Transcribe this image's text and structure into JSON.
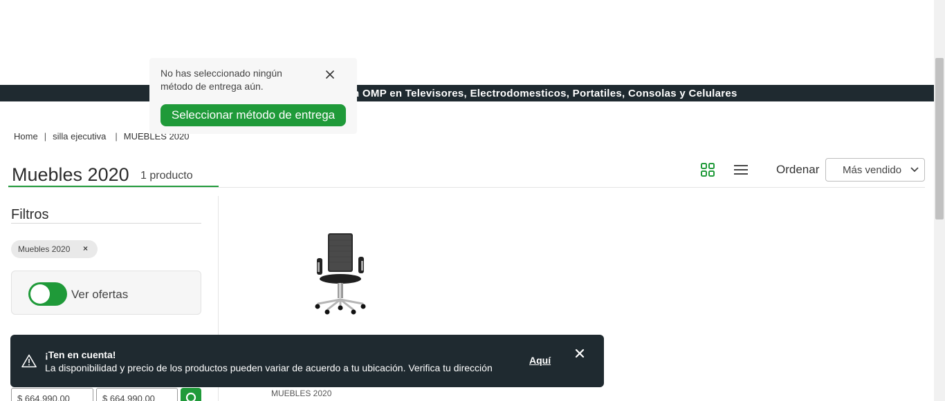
{
  "announcement": {
    "text": "n OMP en Televisores, Electrodomesticos, Portatiles, Consolas y Celulares"
  },
  "delivery_popover": {
    "message": "No has seleccionado ningún método de entrega aún.",
    "cta_label": "Seleccionar método de entrega",
    "close_icon": "close-icon"
  },
  "breadcrumb": [
    "Home",
    "silla ejecutiva",
    "MUEBLES 2020"
  ],
  "header": {
    "title": "Muebles 2020",
    "count": "1 producto"
  },
  "view_toggle": {
    "grid_icon": "grid-view-icon",
    "list_icon": "list-view-icon",
    "active": "grid"
  },
  "sort": {
    "label": "Ordenar",
    "value": "Más vendido"
  },
  "filters": {
    "title": "Filtros",
    "active_chip": "Muebles 2020",
    "chip_remove": "×",
    "offers_toggle_label": "Ver ofertas",
    "offers_toggle_on": true,
    "price_min": "$ 664.990,00",
    "price_max": "$ 664.990,00"
  },
  "product": {
    "image_icon": "office-chair-image",
    "brand": "MUEBLES 2020"
  },
  "toast": {
    "title": "¡Ten en cuenta!",
    "body": "La disponibilidad y precio de los productos pueden variar de acuerdo a tu ubicación. Verifica tu dirección",
    "link": "Aquí"
  },
  "colors": {
    "brand_green": "#1f9a39",
    "dark_bar": "#1f2a30"
  }
}
